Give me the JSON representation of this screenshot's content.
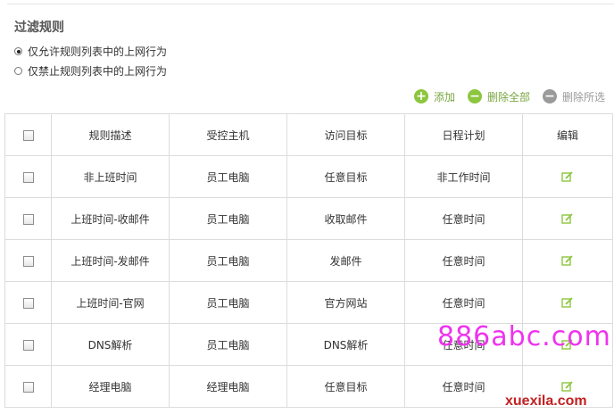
{
  "section": {
    "title": "过滤规则"
  },
  "mode": {
    "options": [
      {
        "label": "仅允许规则列表中的上网行为",
        "checked": true
      },
      {
        "label": "仅禁止规则列表中的上网行为",
        "checked": false
      }
    ]
  },
  "toolbar": {
    "add_label": "添加",
    "delete_all_label": "删除全部",
    "delete_selected_label": "删除所选"
  },
  "table": {
    "headers": [
      "规则描述",
      "受控主机",
      "访问目标",
      "日程计划",
      "编辑"
    ],
    "rows": [
      [
        "非上班时间",
        "员工电脑",
        "任意目标",
        "非工作时间"
      ],
      [
        "上班时间-收邮件",
        "员工电脑",
        "收取邮件",
        "任意时间"
      ],
      [
        "上班时间-发邮件",
        "员工电脑",
        "发邮件",
        "任意时间"
      ],
      [
        "上班时间-官网",
        "员工电脑",
        "官方网站",
        "任意时间"
      ],
      [
        "DNS解析",
        "员工电脑",
        "DNS解析",
        "任意时间"
      ],
      [
        "经理电脑",
        "经理电脑",
        "任意目标",
        "任意时间"
      ]
    ]
  },
  "watermarks": {
    "primary": "886abc.com",
    "secondary": "xuexila.com"
  },
  "colors": {
    "accent_green": "#8cc63f",
    "disabled_gray": "#9a9a9a",
    "border": "#dcdcdc"
  },
  "icons": {
    "add": "plus-circle-icon",
    "delete_all": "minus-circle-icon",
    "delete_selected": "minus-circle-icon",
    "edit": "edit-pencil-icon"
  }
}
